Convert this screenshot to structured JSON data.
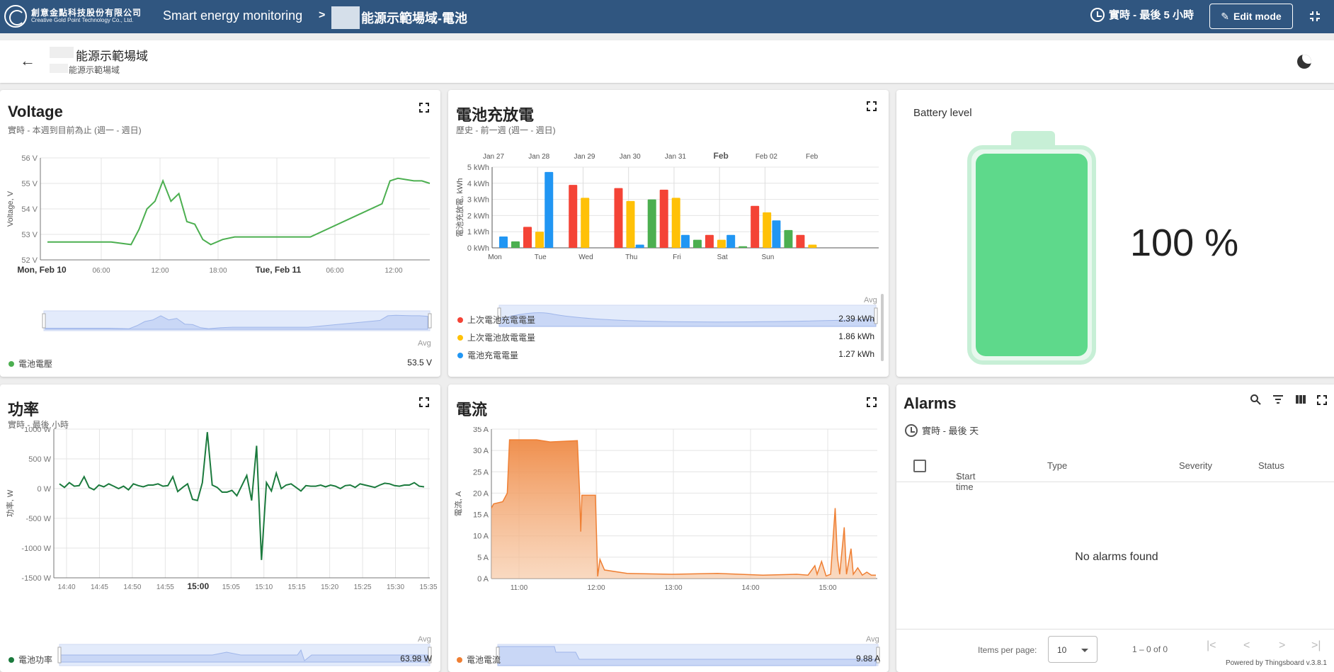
{
  "topbar": {
    "logo_zh": "創意金點科技股份有限公司",
    "logo_en": "Creative Gold Point Technology Co., Ltd.",
    "app_title": "Smart energy monitoring",
    "breadcrumb_sep": ">",
    "page_title": "能源示範場域-電池",
    "timewindow": "實時 - 最後 5 小時",
    "edit_label": "Edit mode"
  },
  "header": {
    "title": "能源示範場域",
    "subtitle": "能源示範場域"
  },
  "voltage": {
    "title": "Voltage",
    "subtitle": "實時 - 本週到目前為止 (週一 - 週日)",
    "legend": "電池電壓",
    "avg_label": "Avg",
    "avg_value": "53.5 V",
    "chart_data": {
      "type": "line",
      "ylabel": "Voltage, V",
      "y_ticks": [
        "56 V",
        "55 V",
        "54 V",
        "53 V",
        "52 V"
      ],
      "ylim": [
        52,
        56
      ],
      "x_ticks": [
        "Mon, Feb 10",
        "06:00",
        "12:00",
        "18:00",
        "Tue, Feb 11",
        "06:00",
        "12:00"
      ],
      "series": [
        {
          "name": "電池電壓",
          "color": "#4caf50",
          "points": [
            [
              0,
              52.7
            ],
            [
              8,
              52.7
            ],
            [
              10.5,
              52.6
            ],
            [
              11.5,
              53.2
            ],
            [
              12.5,
              54.0
            ],
            [
              13.5,
              54.3
            ],
            [
              14.5,
              55.1
            ],
            [
              15.5,
              54.3
            ],
            [
              16.5,
              54.6
            ],
            [
              17.5,
              53.5
            ],
            [
              18.5,
              53.4
            ],
            [
              19.5,
              52.8
            ],
            [
              20.5,
              52.6
            ],
            [
              22,
              52.8
            ],
            [
              23.5,
              52.9
            ],
            [
              28,
              52.9
            ],
            [
              33,
              52.9
            ],
            [
              42,
              54.2
            ],
            [
              43,
              55.1
            ],
            [
              44,
              55.2
            ],
            [
              46,
              55.1
            ],
            [
              47,
              55.1
            ],
            [
              48,
              55.0
            ]
          ]
        }
      ]
    }
  },
  "battery_charge": {
    "title": "電池充放電",
    "subtitle": "歷史 - 前一週 (週一 - 週日)",
    "avg_label": "Avg",
    "legend": [
      {
        "name": "上次電池充電電量",
        "value": "2.39 kWh",
        "color": "#f44336"
      },
      {
        "name": "上次電池放電電量",
        "value": "1.86 kWh",
        "color": "#ffc107"
      },
      {
        "name": "電池充電電量",
        "value": "1.27 kWh",
        "color": "#2196f3"
      }
    ],
    "chart_data": {
      "type": "bar",
      "ylabel": "電池充放電, kWh",
      "y_ticks": [
        "5 kWh",
        "4 kWh",
        "3 kWh",
        "2 kWh",
        "1 kWh",
        "0 kWh"
      ],
      "ylim": [
        0,
        5
      ],
      "top_ticks": [
        "Jan 27",
        "Jan 28",
        "Jan 29",
        "Jan 30",
        "Jan 31",
        "Feb",
        "Feb 02",
        "Feb"
      ],
      "categories": [
        "Mon",
        "Tue",
        "Wed",
        "Thu",
        "Fri",
        "Sat",
        "Sun"
      ],
      "series": [
        {
          "name": "電池充電電量",
          "color": "#2196f3",
          "values": [
            0.7,
            4.7,
            0,
            0.2,
            0.8,
            0.8,
            1.7
          ]
        },
        {
          "name": "電池放電電量",
          "color": "#4caf50",
          "values": [
            0.4,
            0,
            0,
            3.0,
            0.5,
            0.1,
            1.1
          ]
        },
        {
          "name": "上次電池充電電量",
          "color": "#f44336",
          "values": [
            1.3,
            3.9,
            3.7,
            3.6,
            0.8,
            2.6,
            0.8
          ]
        },
        {
          "name": "上次電池放電電量",
          "color": "#ffc107",
          "values": [
            1.0,
            3.1,
            2.9,
            3.1,
            0.5,
            2.2,
            0.2
          ]
        }
      ]
    }
  },
  "battery_level": {
    "title": "Battery level",
    "value": "100 %",
    "level_fraction": 1.0
  },
  "power": {
    "title": "功率",
    "subtitle": "實時 - 最後 小時",
    "legend": "電池功率",
    "avg_label": "Avg",
    "avg_value": "63.98 W",
    "chart_data": {
      "type": "line",
      "ylabel": "功率, W",
      "y_ticks": [
        "1000 W",
        "500 W",
        "0 W",
        "-500 W",
        "-1000 W",
        "-1500 W"
      ],
      "ylim": [
        -1500,
        1000
      ],
      "x_ticks": [
        "14:40",
        "14:45",
        "14:50",
        "14:55",
        "15:00",
        "15:05",
        "15:10",
        "15:15",
        "15:20",
        "15:25",
        "15:30",
        "15:35"
      ],
      "series": [
        {
          "name": "電池功率",
          "color": "#1b7a3d",
          "values": [
            80,
            20,
            100,
            40,
            50,
            200,
            20,
            -20,
            60,
            30,
            80,
            40,
            0,
            40,
            -20,
            80,
            50,
            30,
            60,
            60,
            80,
            40,
            50,
            200,
            -50,
            20,
            80,
            -180,
            -200,
            100,
            950,
            60,
            20,
            -60,
            -60,
            -30,
            -120,
            50,
            220,
            -200,
            720,
            -1200,
            100,
            -40,
            260,
            0,
            60,
            80,
            20,
            -40,
            50,
            40,
            40,
            60,
            30,
            60,
            40,
            0,
            50,
            60,
            20,
            80,
            60,
            40,
            20,
            60,
            90,
            80,
            50,
            40,
            60,
            60,
            100,
            40,
            30
          ]
        }
      ]
    }
  },
  "current": {
    "title": "電流",
    "legend": "電池電流",
    "avg_label": "Avg",
    "avg_value": "9.88 A",
    "chart_data": {
      "type": "area",
      "ylabel": "電流, A",
      "y_ticks": [
        "35 A",
        "30 A",
        "25 A",
        "20 A",
        "15 A",
        "10 A",
        "5 A",
        "0 A"
      ],
      "ylim": [
        0,
        35
      ],
      "x_ticks": [
        "11:00",
        "12:00",
        "13:00",
        "14:00",
        "15:00"
      ],
      "series": [
        {
          "name": "電池電流",
          "color": "#ef7f33",
          "points": [
            [
              0,
              16.5
            ],
            [
              1,
              17.5
            ],
            [
              5,
              18
            ],
            [
              6,
              19
            ],
            [
              7,
              20
            ],
            [
              8,
              32.5
            ],
            [
              20,
              32.5
            ],
            [
              26,
              32
            ],
            [
              38,
              32.3
            ],
            [
              39,
              20
            ],
            [
              39.5,
              11
            ],
            [
              40,
              19.5
            ],
            [
              45,
              19.5
            ],
            [
              46,
              19.5
            ],
            [
              47,
              0.5
            ],
            [
              48,
              4.5
            ],
            [
              50,
              2
            ],
            [
              60,
              1.2
            ],
            [
              80,
              1
            ],
            [
              100,
              1.2
            ],
            [
              120,
              0.8
            ],
            [
              135,
              1
            ],
            [
              140,
              0.8
            ],
            [
              143,
              3
            ],
            [
              144,
              1
            ],
            [
              146,
              4
            ],
            [
              148,
              0.6
            ],
            [
              150,
              1
            ],
            [
              152,
              16.5
            ],
            [
              153,
              5
            ],
            [
              154,
              1
            ],
            [
              156,
              12
            ],
            [
              157,
              1
            ],
            [
              159,
              7
            ],
            [
              160,
              1
            ],
            [
              162,
              2.5
            ],
            [
              164,
              0.8
            ],
            [
              166,
              1.5
            ],
            [
              168,
              0.8
            ],
            [
              170,
              0.8
            ]
          ]
        }
      ]
    }
  },
  "alarms": {
    "title": "Alarms",
    "timewindow": "實時 - 最後 天",
    "columns": [
      "Start time",
      "Type",
      "Severity",
      "Status"
    ],
    "empty_text": "No alarms found",
    "items_per_page_label": "Items per page:",
    "items_per_page": "10",
    "range_label": "1 – 0 of 0",
    "powered_by": "Powered by Thingsboard v.3.8.1"
  }
}
